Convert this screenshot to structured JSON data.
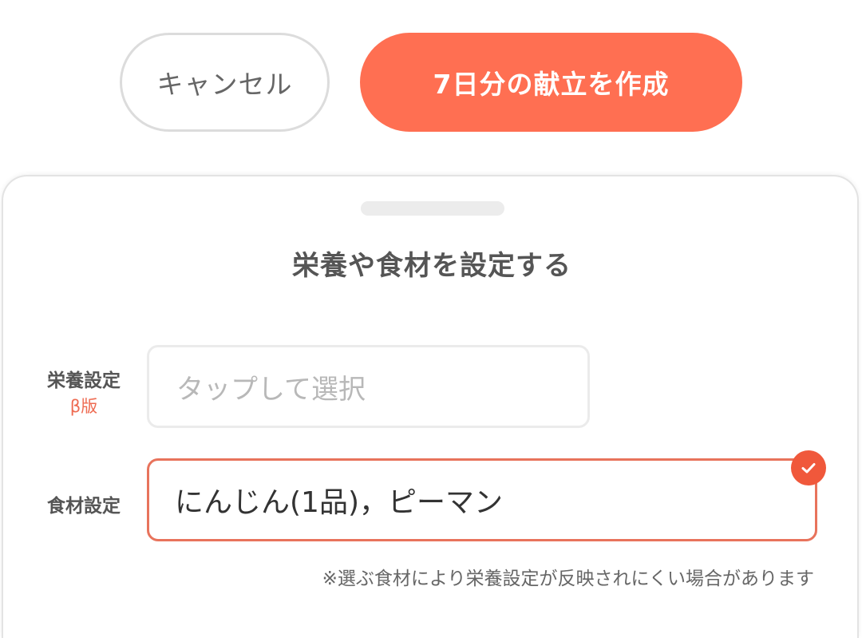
{
  "actions": {
    "cancel_label": "キャンセル",
    "create_label": "7日分の献立を作成"
  },
  "sheet": {
    "title": "栄養や食材を設定する",
    "nutrition": {
      "label": "栄養設定",
      "badge": "β版",
      "placeholder": "タップして選択"
    },
    "ingredients": {
      "label": "食材設定",
      "value": "にんじん(1品)，ピーマン",
      "status_icon": "check-icon"
    },
    "note": "※選ぶ食材により栄養設定が反映されにくい場合があります"
  },
  "colors": {
    "accent": "#ff6f52",
    "check": "#f0583b",
    "beta": "#ee6b52"
  }
}
